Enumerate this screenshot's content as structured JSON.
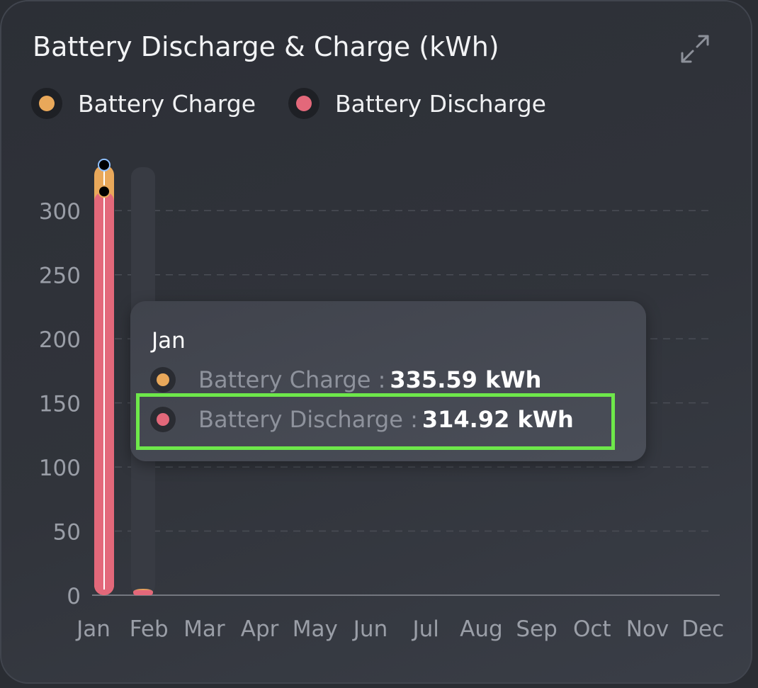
{
  "chart_data": {
    "type": "bar",
    "title": "Battery Discharge & Charge (kWh)",
    "categories": [
      "Jan",
      "Feb",
      "Mar",
      "Apr",
      "May",
      "Jun",
      "Jul",
      "Aug",
      "Sep",
      "Oct",
      "Nov",
      "Dec"
    ],
    "series": [
      {
        "name": "Battery Charge",
        "color": "#e9a85a",
        "values": [
          335.59,
          5,
          null,
          null,
          null,
          null,
          null,
          null,
          null,
          null,
          null,
          null
        ]
      },
      {
        "name": "Battery Discharge",
        "color": "#e3687a",
        "values": [
          314.92,
          4,
          null,
          null,
          null,
          null,
          null,
          null,
          null,
          null,
          null,
          null
        ]
      }
    ],
    "yticks": [
      0,
      50,
      100,
      150,
      200,
      250,
      300
    ],
    "ylim": [
      0,
      300
    ],
    "grid": true,
    "legend_position": "top-left"
  },
  "tooltip": {
    "title": "Jan",
    "rows": [
      {
        "label": "Battery Charge :",
        "value": "335.59 kWh",
        "color": "#e9a85a"
      },
      {
        "label": "Battery Discharge :",
        "value": "314.92 kWh",
        "color": "#e3687a"
      }
    ]
  },
  "icons": {
    "expand": "expand-icon"
  },
  "colors": {
    "highlight": "#6ee84a",
    "track": "#383b43"
  }
}
